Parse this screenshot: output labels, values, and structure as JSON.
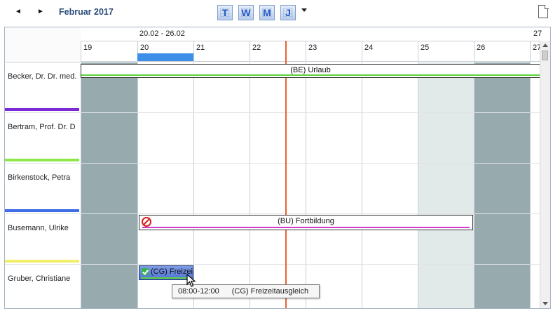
{
  "toolbar": {
    "prev_label": "◄",
    "next_label": "►",
    "month_label": "Februar 2017",
    "views": [
      "T",
      "W",
      "M",
      "J"
    ]
  },
  "calendar": {
    "week_label": "20.02 - 26.02",
    "next_week_label": "27",
    "days": [
      "19",
      "20",
      "21",
      "22",
      "23",
      "24",
      "25",
      "26",
      "27"
    ],
    "rows": [
      {
        "name": "Becker, Dr. Dr. med.",
        "color": "#7b2bd6"
      },
      {
        "name": "Bertram, Prof. Dr. D",
        "color": "#8fe84a"
      },
      {
        "name": "Birkenstock, Petra",
        "color": "#3f6ee8"
      },
      {
        "name": "Busemann, Ulrike",
        "color": "#f1ef6a"
      },
      {
        "name": "Gruber, Christiane",
        "color": "#f07a3a"
      }
    ],
    "events": [
      {
        "label": "(BE) Urlaub",
        "underline_color": "#5cd23a"
      },
      {
        "label": "(BU) Fortbildung",
        "underline_color": "#d33ad1"
      },
      {
        "label": "(CG) Freizei",
        "underline_color": "#5cd23a"
      }
    ],
    "tooltip": {
      "time": "08:00-12:00",
      "text": "(CG) Freizeitausgleich"
    }
  },
  "colors": {
    "weekend": "#97abae",
    "saturday_light": "#e2e9e9",
    "now_line": "#e8632f",
    "today_marker": "#3d8ee8"
  }
}
